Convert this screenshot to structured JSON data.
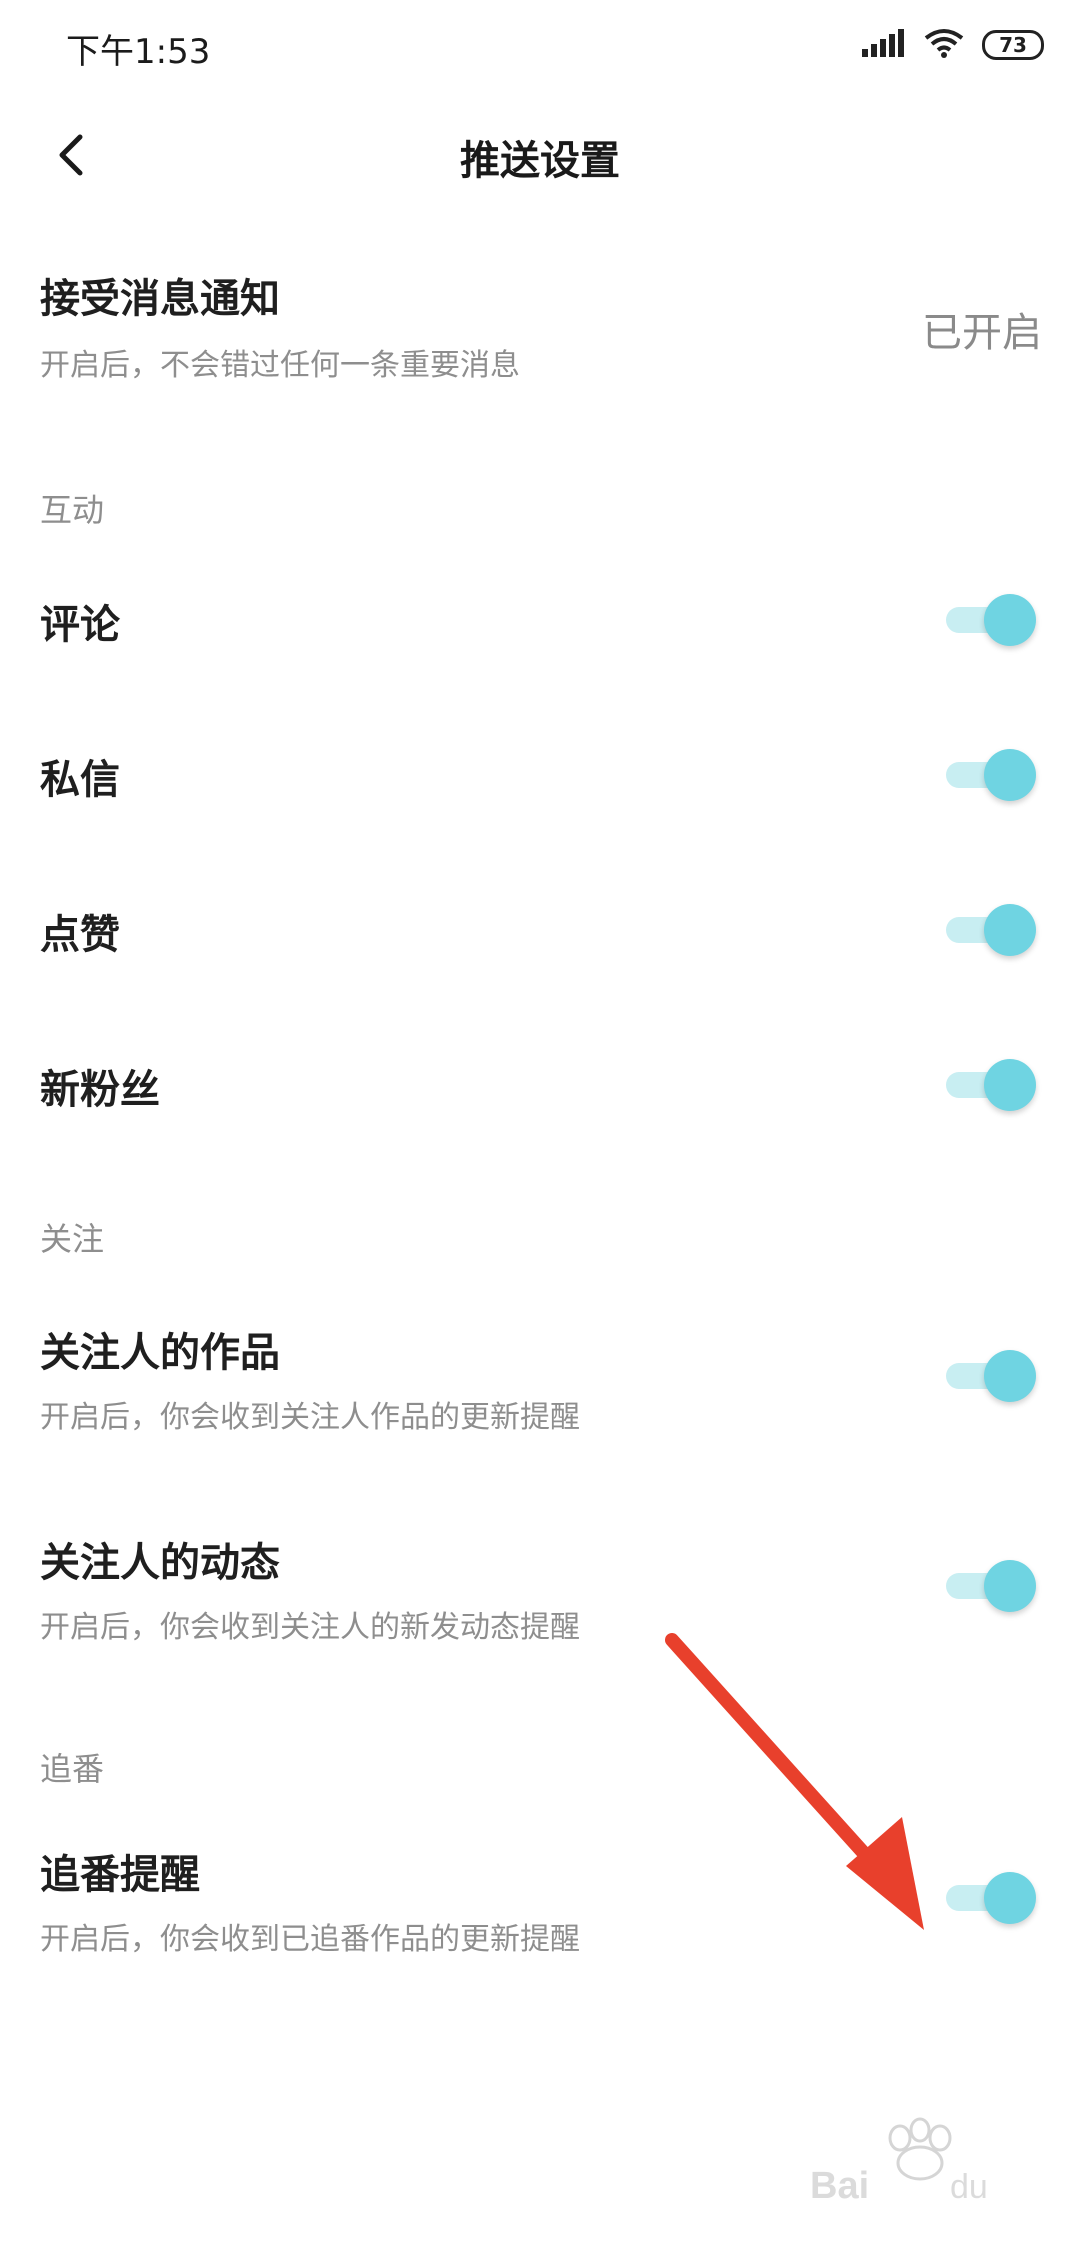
{
  "status_bar": {
    "time": "下午1:53",
    "battery": "73"
  },
  "header": {
    "title": "推送设置"
  },
  "receive": {
    "title": "接受消息通知",
    "subtitle": "开启后，不会错过任何一条重要消息",
    "status": "已开启"
  },
  "sections": {
    "interaction": "互动",
    "follow": "关注",
    "anime": "追番"
  },
  "items": {
    "comment": {
      "title": "评论",
      "on": true
    },
    "message": {
      "title": "私信",
      "on": true
    },
    "like": {
      "title": "点赞",
      "on": true
    },
    "new_fans": {
      "title": "新粉丝",
      "on": true
    },
    "followed_works": {
      "title": "关注人的作品",
      "subtitle": "开启后，你会收到关注人作品的更新提醒",
      "on": true
    },
    "followed_moments": {
      "title": "关注人的动态",
      "subtitle": "开启后，你会收到关注人的新发动态提醒",
      "on": true
    },
    "anime_reminder": {
      "title": "追番提醒",
      "subtitle": "开启后，你会收到已追番作品的更新提醒",
      "on": true
    }
  },
  "colors": {
    "toggle_knob": "#6fd4e2",
    "toggle_track": "#c8eef2",
    "annotation_arrow": "#e8402c"
  },
  "icons": [
    "signal-icon",
    "wifi-icon",
    "battery-icon",
    "back-arrow-icon",
    "annotation-arrow",
    "baidu-watermark"
  ]
}
